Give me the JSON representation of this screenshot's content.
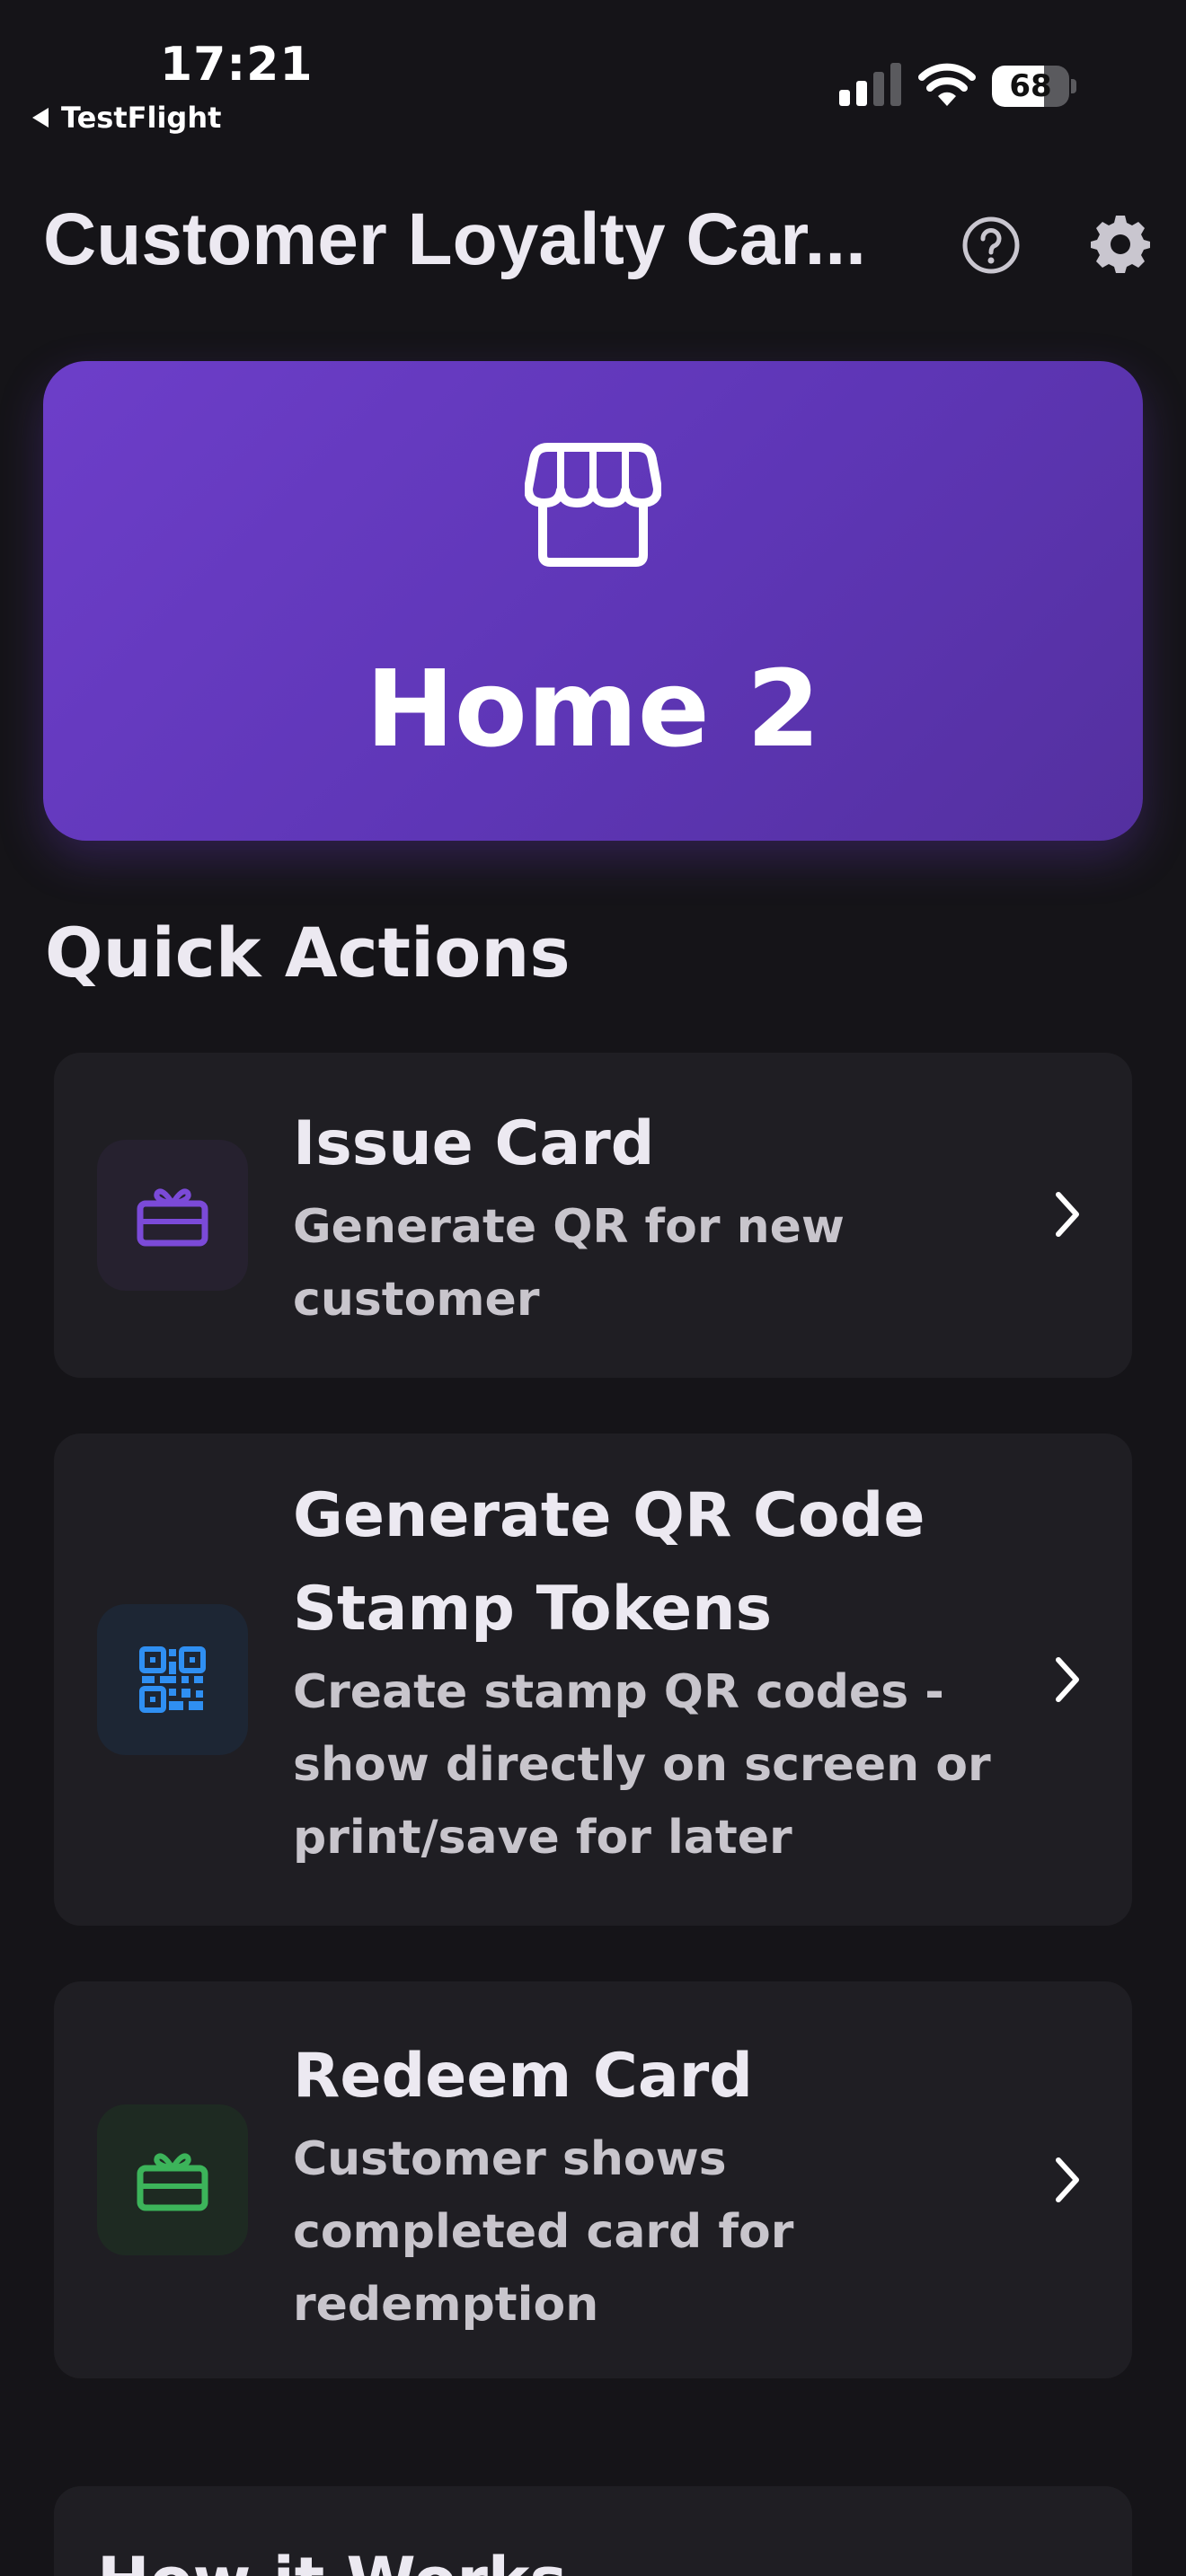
{
  "status_bar": {
    "time": "17:21",
    "back_app": "TestFlight",
    "battery": "68",
    "battery_level": 0.68
  },
  "header": {
    "title": "Customer Loyalty Car...",
    "help_icon": "question-circle-icon",
    "settings_icon": "gear-icon"
  },
  "store": {
    "icon": "storefront-icon",
    "name": "Home 2",
    "colors": {
      "start": "#6d3ec9",
      "end": "#54309f"
    }
  },
  "quick_actions": {
    "title": "Quick Actions",
    "items": [
      {
        "title": "Issue Card",
        "description_lines": [
          "Generate QR for new",
          "customer"
        ],
        "icon": "gift-card-icon",
        "color": "#7b4ad8"
      },
      {
        "title_lines": [
          "Generate QR Code",
          "Stamp Tokens"
        ],
        "description_lines": [
          "Create stamp QR codes -",
          "show directly on screen or",
          "print/save for later"
        ],
        "icon": "qr-code-icon",
        "color": "#2f8ff2"
      },
      {
        "title": "Redeem Card",
        "description_lines": [
          "Customer shows",
          "completed card for",
          "redemption"
        ],
        "icon": "gift-card-icon",
        "color": "#3cb45a"
      }
    ]
  },
  "how_it_works": {
    "title": "How it Works"
  }
}
